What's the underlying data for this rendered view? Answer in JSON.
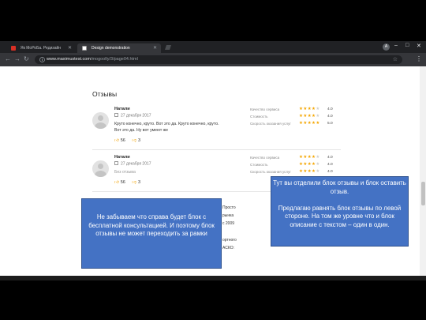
{
  "browser": {
    "tabs": [
      {
        "label": "Як МоРоБа. Редизайн",
        "active": false,
        "favicon_color": "#d93025"
      },
      {
        "label": "Design demonstration",
        "active": true,
        "favicon_color": "#ffffff"
      }
    ],
    "url_host": "www.maximustest.com",
    "url_path": "/mogoolly/3/page04.html",
    "profile_initial": "A",
    "window_controls": [
      "–",
      "□",
      "✕"
    ]
  },
  "reviews_section": {
    "title": "Отзывы",
    "items": [
      {
        "author": "Натали",
        "date": "27 декабря 2017",
        "text": "Круто конечно, круто. Вот это да. Круто конечно, круто. Вот это да. Ну вот умеют же",
        "likes": "56",
        "dislikes": "3",
        "ratings": [
          {
            "label": "Качество сервиса",
            "stars": 4,
            "value": "4.0"
          },
          {
            "label": "Стоимость",
            "stars": 4,
            "value": "4.0"
          },
          {
            "label": "Скорость оказания услуг",
            "stars": 5,
            "value": "5.0"
          }
        ]
      },
      {
        "author": "Натали",
        "date": "27 декабря 2017",
        "text": "Без отзыва",
        "likes": "56",
        "dislikes": "3",
        "ratings": [
          {
            "label": "Качество сервиса",
            "stars": 4,
            "value": "4.0"
          },
          {
            "label": "Стоимость",
            "stars": 4,
            "value": "4.0"
          },
          {
            "label": "Скорость оказания услуг",
            "stars": 4,
            "value": "4.0"
          }
        ]
      }
    ],
    "partial_lines": [
      "Просто",
      "рынка",
      "с 2009",
      "ортного",
      "АСКО:"
    ]
  },
  "callouts": {
    "left": "Не забываем что справа будет блок с бесплатной консультацией. И поэтому блок отзывы не может переходить за рамки",
    "right": "Тут вы отделили блок отзывы и блок оставить отзыв.\n\nПредлагаю равнять блок отзывы по левой стороне. На том же уровне что и блок описание с текстом – один в один."
  },
  "colors": {
    "callout_fill": "#4472c4",
    "star_on": "#f4a600",
    "star_off": "#cfcfcf",
    "chrome_dark": "#202124"
  }
}
